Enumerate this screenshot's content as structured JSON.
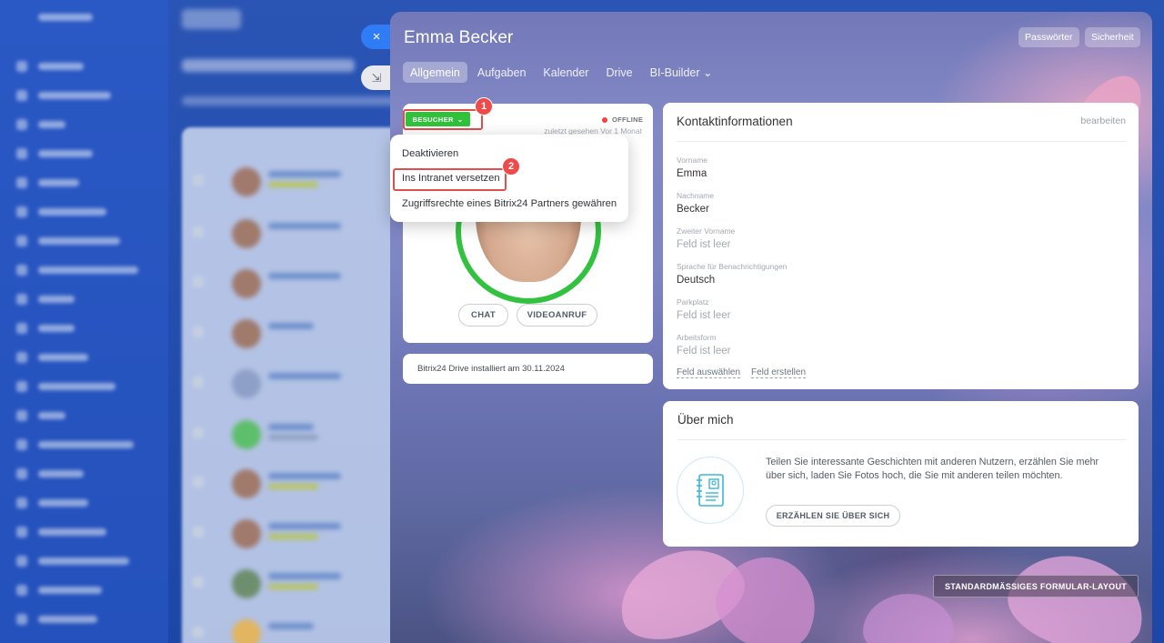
{
  "panel": {
    "title": "Emma Becker",
    "header_buttons": {
      "passwords": "Passwörter",
      "security": "Sicherheit"
    },
    "tabs": [
      {
        "label": "Allgemein",
        "active": true
      },
      {
        "label": "Aufgaben",
        "active": false
      },
      {
        "label": "Kalender",
        "active": false
      },
      {
        "label": "Drive",
        "active": false
      },
      {
        "label": "BI-Builder ⌄",
        "active": false
      }
    ]
  },
  "side_buttons": {
    "close_icon": "×",
    "minimize_icon": "⇲"
  },
  "profile": {
    "role_badge": "BESUCHER",
    "role_badge_chevron": "⌄",
    "status": "OFFLINE",
    "last_seen": "zuletzt gesehen Vor 1 Monat",
    "chat_button": "CHAT",
    "video_button": "VIDEOANRUF",
    "drive_info": "Bitrix24 Drive installiert am 30.11.2024"
  },
  "role_menu": {
    "items": [
      "Deaktivieren",
      "Ins Intranet versetzen",
      "Zugriffsrechte eines Bitrix24 Partners gewähren"
    ]
  },
  "annotations": {
    "step1": "1",
    "step2": "2"
  },
  "contact": {
    "title": "Kontaktinformationen",
    "edit": "bearbeiten",
    "fields": [
      {
        "label": "Vorname",
        "value": "Emma"
      },
      {
        "label": "Nachname",
        "value": "Becker"
      },
      {
        "label": "Zweiter Vorname",
        "value": "Feld ist leer"
      },
      {
        "label": "Sprache für Benachrichtigungen",
        "value": "Deutsch"
      },
      {
        "label": "Parkplatz",
        "value": "Feld ist leer"
      },
      {
        "label": "Arbeitsform",
        "value": "Feld ist leer"
      }
    ],
    "select_field": "Feld auswählen",
    "create_field": "Feld erstellen"
  },
  "about": {
    "title": "Über mich",
    "text": "Teilen Sie interessante Geschichten mit anderen Nutzern, erzählen Sie mehr über sich, laden Sie Fotos hoch, die Sie mit anderen teilen möchten.",
    "button": "ERZÄHLEN SIE ÜBER SICH"
  },
  "standard_layout_button": "STANDARDMÄSSIGES FORMULAR-LAYOUT",
  "colors": {
    "accent_blue": "#2f7cf6",
    "badge_green": "#31c23c",
    "annotation_red": "#ef4a4a",
    "offline_red": "#f34242"
  }
}
